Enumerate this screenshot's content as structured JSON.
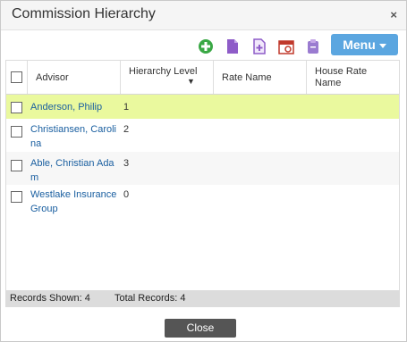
{
  "window": {
    "title": "Commission Hierarchy",
    "close_icon": "×"
  },
  "toolbar": {
    "icons": [
      "add-icon",
      "document-icon",
      "new-document-icon",
      "calendar-icon",
      "clipboard-icon"
    ],
    "menu_label": "Menu"
  },
  "grid": {
    "columns": [
      "Advisor",
      "Hierarchy Level",
      "Rate Name",
      "House Rate Name"
    ],
    "sort_indicator": "▼",
    "rows": [
      {
        "advisor": "Anderson, Philip",
        "level": "1",
        "highlighted": true
      },
      {
        "advisor": "Christiansen, Carolina",
        "level": "2",
        "highlighted": false
      },
      {
        "advisor": "Able, Christian Adam",
        "level": "3",
        "highlighted": false
      },
      {
        "advisor": "Westlake Insurance Group",
        "level": "0",
        "highlighted": false
      }
    ],
    "footer": {
      "records_shown": "Records Shown: 4",
      "total_records": "Total Records: 4"
    }
  },
  "actions": {
    "close_label": "Close"
  },
  "colors": {
    "menu_button": "#5ba6e0",
    "highlight_row": "#eaf99e",
    "link": "#1a5fa0",
    "close_button": "#555555"
  }
}
